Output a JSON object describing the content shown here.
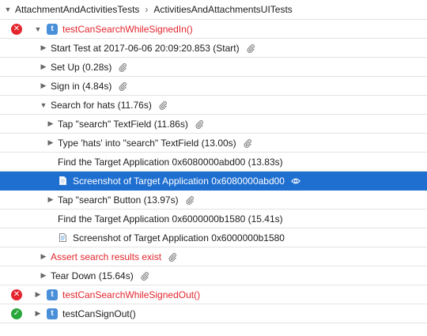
{
  "breadcrumb": {
    "parent": "AttachmentAndActivitiesTests",
    "separator": "›",
    "current": "ActivitiesAndAttachmentsUITests"
  },
  "test1": {
    "name": "testCanSearchWhileSignedIn()"
  },
  "steps": {
    "start_test": "Start Test at 2017-06-06 20:09:20.853 (Start)",
    "set_up": "Set Up (0.28s)",
    "sign_in": "Sign in (4.84s)",
    "search_hats": "Search for hats (11.76s)",
    "tap_search_field": "Tap \"search\" TextField (11.86s)",
    "type_hats": "Type 'hats' into \"search\" TextField (13.00s)",
    "find_app_1": "Find the Target Application 0x6080000abd00 (13.83s)",
    "screenshot_1": "Screenshot of Target Application 0x6080000abd00",
    "tap_search_button": "Tap \"search\" Button (13.97s)",
    "find_app_2": "Find the Target Application 0x6000000b1580 (15.41s)",
    "screenshot_2": "Screenshot of Target Application 0x6000000b1580",
    "assert_results": "Assert search results exist",
    "tear_down": "Tear Down (15.64s)"
  },
  "test2": {
    "name": "testCanSearchWhileSignedOut()"
  },
  "test3": {
    "name": "testCanSignOut()"
  },
  "badge_letter": "t",
  "colors": {
    "fail": "#e3262e",
    "pass": "#2aa63a",
    "selection": "#1f6fd1",
    "badge": "#4a90d9"
  },
  "icons": {
    "attachment": "paperclip-icon",
    "quicklook": "eye-icon",
    "screenshot": "document-icon"
  }
}
